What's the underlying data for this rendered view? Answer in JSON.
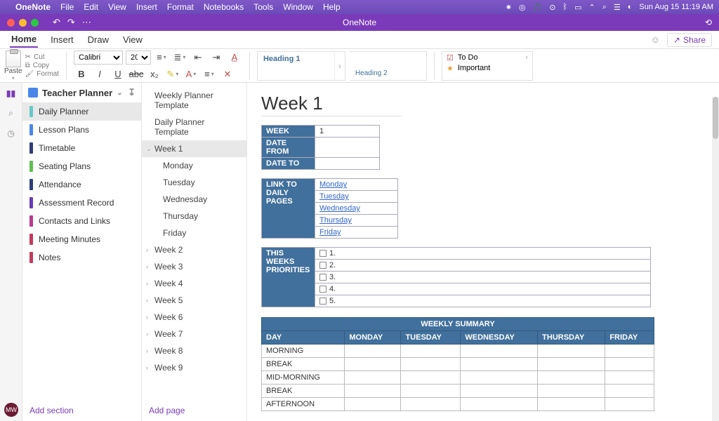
{
  "mac_menu": {
    "app": "OneNote",
    "items": [
      "File",
      "Edit",
      "View",
      "Insert",
      "Format",
      "Notebooks",
      "Tools",
      "Window",
      "Help"
    ],
    "clock": "Sun Aug 15  11:19 AM"
  },
  "titlebar": {
    "title": "OneNote"
  },
  "ribbon_tabs": [
    "Home",
    "Insert",
    "Draw",
    "View"
  ],
  "share_label": "Share",
  "clipboard": {
    "paste": "Paste",
    "cut": "Cut",
    "copy": "Copy",
    "format": "Format"
  },
  "font": {
    "name": "Calibri",
    "size": "20"
  },
  "style_cards": {
    "h1": "Heading 1",
    "h2": "Heading 2"
  },
  "tags": {
    "todo": "To Do",
    "important": "Important"
  },
  "notebook": "Teacher Planner",
  "sections": [
    {
      "label": "Daily Planner",
      "color": "#67c9c9",
      "selected": true
    },
    {
      "label": "Lesson Plans",
      "color": "#4a86e8"
    },
    {
      "label": "Timetable",
      "color": "#2d3e78"
    },
    {
      "label": "Seating Plans",
      "color": "#5fbf4f"
    },
    {
      "label": "Attendance",
      "color": "#2d3e78"
    },
    {
      "label": "Assessment Record",
      "color": "#6a3ab9"
    },
    {
      "label": "Contacts and Links",
      "color": "#b83a8e"
    },
    {
      "label": "Meeting Minutes",
      "color": "#c43a5e"
    },
    {
      "label": "Notes",
      "color": "#c43a5e"
    }
  ],
  "add_section": "Add section",
  "pages": [
    {
      "label": "Weekly Planner Template",
      "lvl": 0
    },
    {
      "label": "Daily Planner Template",
      "lvl": 0
    },
    {
      "label": "Week 1",
      "lvl": 0,
      "selected": true,
      "expanded": true
    },
    {
      "label": "Monday",
      "lvl": 1
    },
    {
      "label": "Tuesday",
      "lvl": 1
    },
    {
      "label": "Wednesday",
      "lvl": 1
    },
    {
      "label": "Thursday",
      "lvl": 1
    },
    {
      "label": "Friday",
      "lvl": 1
    },
    {
      "label": "Week 2",
      "lvl": 0,
      "collapsed": true
    },
    {
      "label": "Week 3",
      "lvl": 0,
      "collapsed": true
    },
    {
      "label": "Week 4",
      "lvl": 0,
      "collapsed": true
    },
    {
      "label": "Week 5",
      "lvl": 0,
      "collapsed": true
    },
    {
      "label": "Week 6",
      "lvl": 0,
      "collapsed": true
    },
    {
      "label": "Week 7",
      "lvl": 0,
      "collapsed": true
    },
    {
      "label": "Week 8",
      "lvl": 0,
      "collapsed": true
    },
    {
      "label": "Week 9",
      "lvl": 0,
      "collapsed": true
    }
  ],
  "add_page": "Add page",
  "page": {
    "title": "Week 1",
    "hdr": {
      "week_l": "WEEK",
      "week_v": "1",
      "from_l": "DATE FROM",
      "from_v": "",
      "to_l": "DATE TO",
      "to_v": ""
    },
    "links": {
      "label": "LINK TO DAILY PAGES",
      "items": [
        "Monday",
        "Tuesday",
        "Wednesday",
        "Thursday",
        "Friday"
      ]
    },
    "prio": {
      "label": "THIS WEEKS PRIORITIES",
      "rows": [
        "1.",
        "2.",
        "3.",
        "4.",
        "5."
      ]
    },
    "summary": {
      "caption": "WEEKLY SUMMARY",
      "cols": [
        "DAY",
        "MONDAY",
        "TUESDAY",
        "WEDNESDAY",
        "THURSDAY",
        "FRIDAY"
      ],
      "rows": [
        "MORNING",
        "BREAK",
        "MID-MORNING",
        "BREAK",
        "AFTERNOON"
      ]
    }
  },
  "avatar": "MW"
}
